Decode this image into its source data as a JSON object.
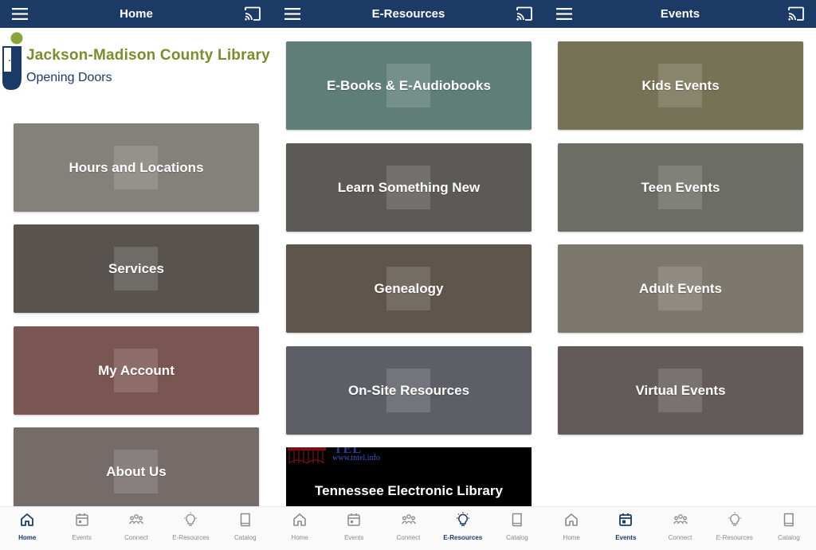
{
  "colors": {
    "topbar": "#1c3a66",
    "tab_active": "#1c3a66",
    "tab_inactive": "#8a8a8a",
    "logo_green": "#7c8c2c"
  },
  "home": {
    "title": "Home",
    "logo": {
      "line1": "Jackson-Madison County Library",
      "line2": "Opening Doors"
    },
    "tiles": [
      {
        "label": "Hours and Locations",
        "color": "#84807a"
      },
      {
        "label": "Services",
        "color": "#58534e"
      },
      {
        "label": "My Account",
        "color": "#7a5652"
      },
      {
        "label": "About Us",
        "color": "#756c69"
      }
    ],
    "active_tab": "Home"
  },
  "eresources": {
    "title": "E-Resources",
    "tiles": [
      {
        "label": "E-Books & E-Audiobooks",
        "color": "#5f7e77"
      },
      {
        "label": "Learn Something New",
        "color": "#5c5a56"
      },
      {
        "label": "Genealogy",
        "color": "#5e554c"
      },
      {
        "label": "On-Site Resources",
        "color": "#5e5e67"
      }
    ],
    "banner": {
      "label": "Tennessee Electronic Library",
      "mark": "TEL",
      "url": "www.tntel.info"
    },
    "active_tab": "E-Resources"
  },
  "events": {
    "title": "Events",
    "tiles": [
      {
        "label": "Kids Events",
        "color": "#767256"
      },
      {
        "label": "Teen Events",
        "color": "#6c6e65"
      },
      {
        "label": "Adult Events",
        "color": "#7d786e"
      },
      {
        "label": "Virtual Events",
        "color": "#625b5a"
      }
    ],
    "active_tab": "Events"
  },
  "tabs": [
    {
      "label": "Home",
      "icon": "home-icon"
    },
    {
      "label": "Events",
      "icon": "calendar-icon"
    },
    {
      "label": "Connect",
      "icon": "people-icon"
    },
    {
      "label": "E-Resources",
      "icon": "lightbulb-icon"
    },
    {
      "label": "Catalog",
      "icon": "book-icon"
    }
  ]
}
